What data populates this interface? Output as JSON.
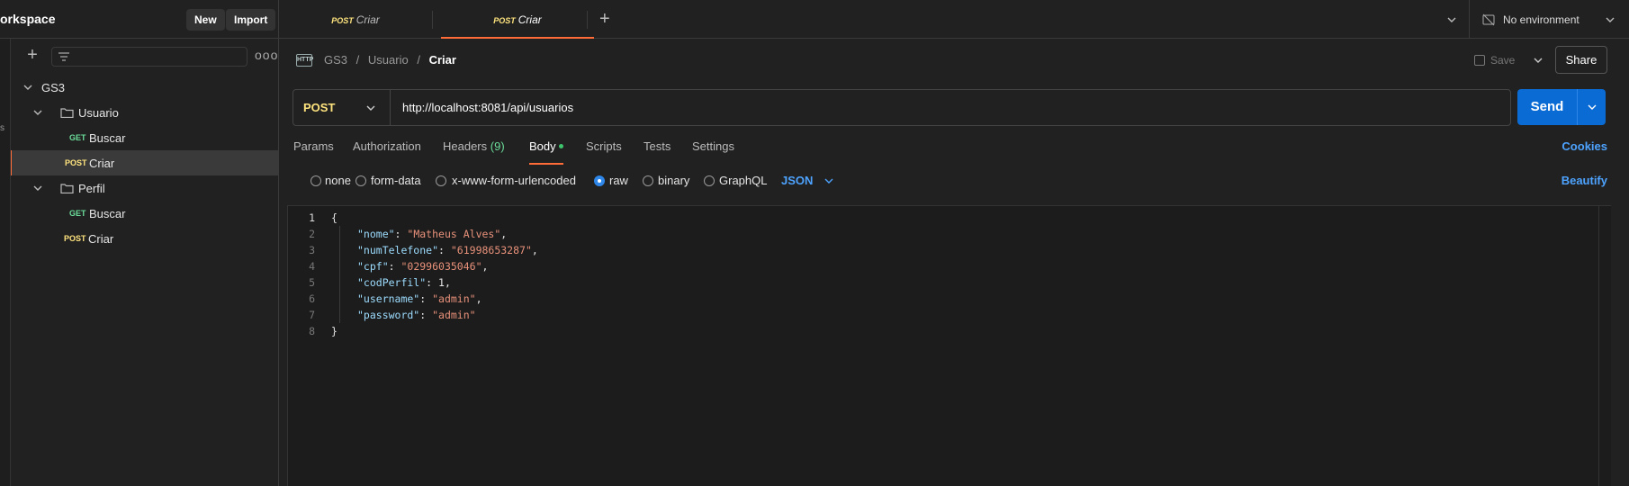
{
  "sidebar": {
    "workspace_title": "orkspace",
    "new_label": "New",
    "import_label": "Import",
    "more_label": "ooo",
    "tree": {
      "collection": "GS3",
      "folder1": "Usuario",
      "folder1_items": [
        {
          "method": "GET",
          "label": "Buscar"
        },
        {
          "method": "POST",
          "label": "Criar"
        }
      ],
      "folder2": "Perfil",
      "folder2_items": [
        {
          "method": "GET",
          "label": "Buscar"
        },
        {
          "method": "POST",
          "label": "Criar"
        }
      ]
    }
  },
  "tabs": [
    {
      "method": "POST",
      "label": "Criar"
    },
    {
      "method": "POST",
      "label": "Criar"
    }
  ],
  "environment": {
    "label": "No environment"
  },
  "request": {
    "breadcrumb": {
      "collection": "GS3",
      "sep": "/",
      "folder": "Usuario",
      "current": "Criar"
    },
    "save_label": "Save",
    "share_label": "Share",
    "method": "POST",
    "url": "http://localhost:8081/api/usuarios",
    "send_label": "Send"
  },
  "request_tabs": {
    "params": "Params",
    "authorization": "Authorization",
    "headers": "Headers",
    "headers_count": "(9)",
    "body": "Body",
    "scripts": "Scripts",
    "tests": "Tests",
    "settings": "Settings",
    "cookies": "Cookies"
  },
  "body_options": {
    "none": "none",
    "form_data": "form-data",
    "urlencoded": "x-www-form-urlencoded",
    "raw": "raw",
    "binary": "binary",
    "graphql": "GraphQL",
    "format": "JSON",
    "beautify": "Beautify"
  },
  "editor": {
    "line_numbers": [
      "1",
      "2",
      "3",
      "4",
      "5",
      "6",
      "7",
      "8"
    ],
    "open_brace": "{",
    "close_brace": "}",
    "fields": [
      {
        "key": "\"nome\"",
        "value": "\"Matheus Alves\"",
        "comma": ","
      },
      {
        "key": "\"numTelefone\"",
        "value": "\"61998653287\"",
        "comma": ","
      },
      {
        "key": "\"cpf\"",
        "value": "\"02996035046\"",
        "comma": ","
      },
      {
        "key": "\"codPerfil\"",
        "value": "1",
        "comma": ","
      },
      {
        "key": "\"username\"",
        "value": "\"admin\"",
        "comma": ","
      },
      {
        "key": "\"password\"",
        "value": "\"admin\"",
        "comma": ""
      }
    ]
  },
  "rail": {
    "glyph": "s"
  },
  "colors": {
    "accent_orange": "#ff6c37",
    "send_blue": "#0b6bd4",
    "post_yellow": "#ffe47e",
    "get_green": "#6bdd9a",
    "link_blue": "#4da3ff"
  }
}
